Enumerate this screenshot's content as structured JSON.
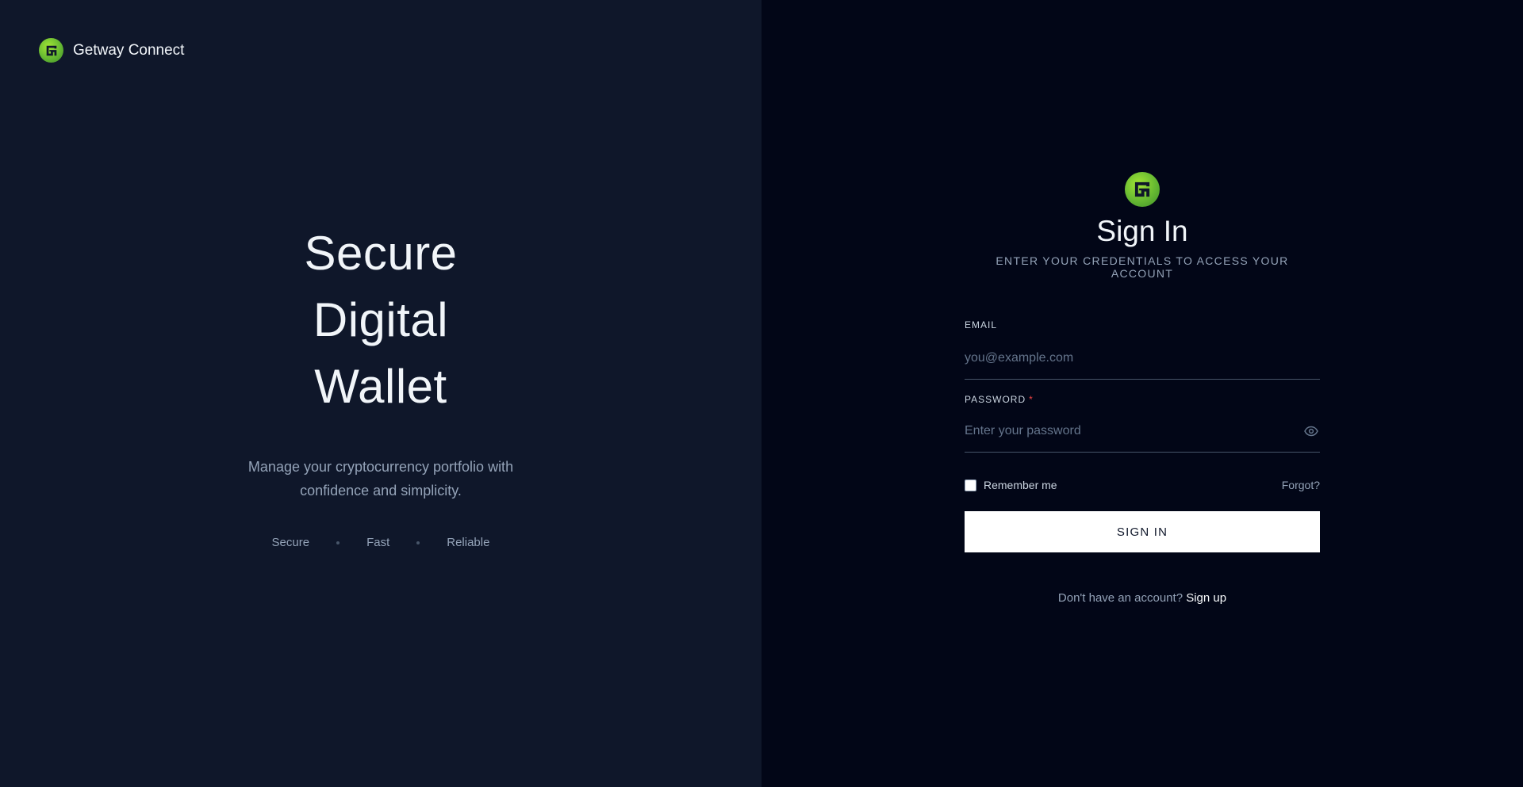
{
  "brand": {
    "name": "Getway Connect",
    "logo_icon": "getway-logo-icon",
    "logo_color": "#7cc63a"
  },
  "hero": {
    "title_lines": [
      "Secure",
      "Digital",
      "Wallet"
    ],
    "subtitle_line1": "Manage your cryptocurrency portfolio with",
    "subtitle_line2": "confidence and simplicity.",
    "features": [
      "Secure",
      "Fast",
      "Reliable"
    ]
  },
  "form": {
    "title": "Sign In",
    "subtitle": "ENTER YOUR CREDENTIALS TO ACCESS YOUR ACCOUNT",
    "email": {
      "label": "EMAIL",
      "placeholder": "you@example.com",
      "value": ""
    },
    "password": {
      "label": "PASSWORD",
      "required_mark": "*",
      "placeholder": "Enter your password",
      "value": "",
      "toggle_icon": "eye-icon"
    },
    "remember_label": "Remember me",
    "remember_checked": false,
    "forgot_label": "Forgot?",
    "submit_label": "SIGN IN",
    "signup_prompt": "Don't have an account?",
    "signup_link": "Sign up"
  },
  "colors": {
    "left_bg": "#0f172a",
    "right_bg": "#020617",
    "button_bg": "#ffffff",
    "required": "#ef4444"
  }
}
